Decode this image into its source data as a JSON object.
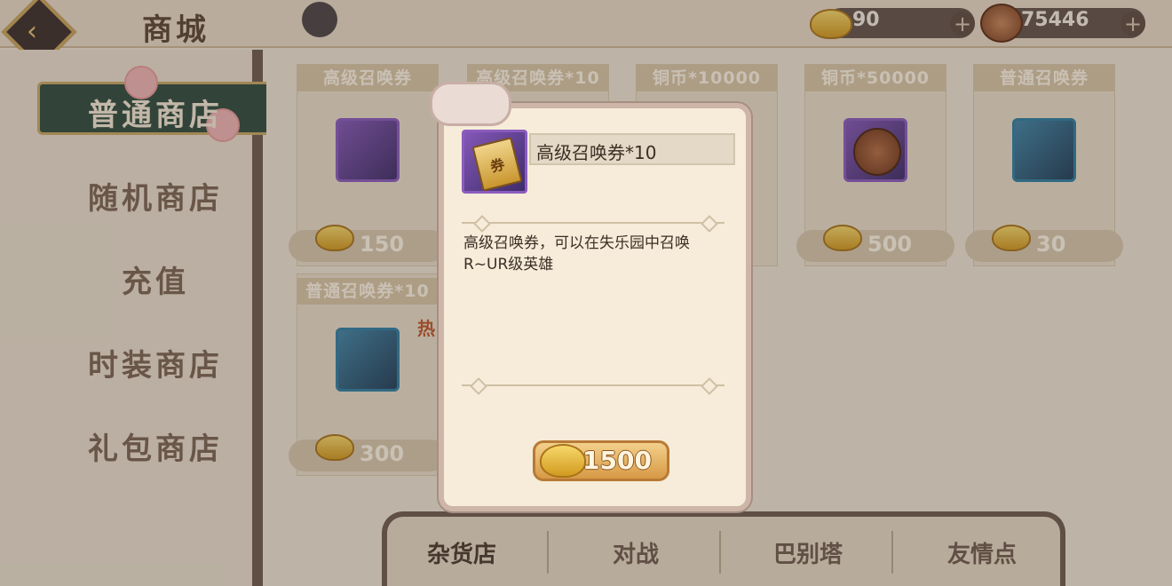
{
  "header": {
    "title": "商城",
    "gold": "90",
    "copper": "75446",
    "plus_label": "+",
    "back_icon": "back-arrow-icon"
  },
  "sidebar": {
    "items": [
      {
        "label": "普通商店",
        "active": true
      },
      {
        "label": "随机商店",
        "active": false
      },
      {
        "label": "充值",
        "active": false
      },
      {
        "label": "时装商店",
        "active": false
      },
      {
        "label": "礼包商店",
        "active": false
      }
    ]
  },
  "shop": {
    "items": [
      {
        "title": "高级召唤券",
        "price": "150",
        "icon": "summon-ticket-gold-icon"
      },
      {
        "title": "高级召唤券*10",
        "price": "",
        "icon": "summon-ticket-gold-icon"
      },
      {
        "title": "铜币*10000",
        "price": "",
        "icon": "copper-coin-icon"
      },
      {
        "title": "铜币*50000",
        "price": "500",
        "icon": "copper-coin-icon"
      },
      {
        "title": "普通召唤券",
        "price": "30",
        "icon": "summon-ticket-blue-icon"
      },
      {
        "title": "普通召唤券*10",
        "price": "300",
        "icon": "summon-ticket-blue-icon"
      }
    ],
    "hot_badge": "热"
  },
  "bottom_tabs": [
    "杂货店",
    "对战",
    "巴别塔",
    "友情点"
  ],
  "popup": {
    "item_name": "高级召唤券*10",
    "icon_glyph": "券",
    "description": "高级召唤券，可以在失乐园中召唤R~UR级英雄",
    "price": "1500",
    "currency_icon": "gold-ingot-icon"
  },
  "colors": {
    "accent_green": "#2f4c3e",
    "border_brown": "#6e5b4e",
    "gold": "#d79a45",
    "popup_bg": "#f6ecd9"
  }
}
